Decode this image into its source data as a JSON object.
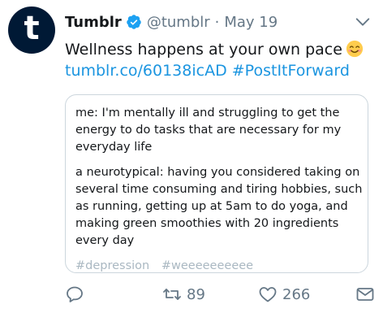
{
  "tweet": {
    "display_name": "Tumblr",
    "handle": "@tumblr",
    "separator": "·",
    "date": "May 19",
    "avatar_letter": "t",
    "text_line1": "Wellness happens at your own pace",
    "emoji_name": "smiling-face-emoji",
    "link": "tumblr.co/60138icAD",
    "hashtag": "#PostItForward"
  },
  "card": {
    "para1": [
      "me: I'm mentally ill and struggling to get the",
      "energy to do tasks that are necessary for my",
      "everyday life"
    ],
    "para2": [
      "a neurotypical: having you considered taking on",
      "several time consuming and tiring hobbies, such",
      "as running, getting up at 5am to do yoga, and",
      "making green smoothies with 20 ingredients",
      "every day"
    ],
    "tags": [
      "#depression",
      "#weeeeeeeeee"
    ]
  },
  "actions": {
    "retweet_count": "89",
    "like_count": "266"
  },
  "colors": {
    "avatar_bg": "#001935",
    "verified": "#1da1f2",
    "link": "#1b95e0",
    "muted": "#657786"
  },
  "icons": [
    "verified-badge-icon",
    "chevron-down-icon",
    "reply-icon",
    "retweet-icon",
    "like-icon",
    "share-icon"
  ]
}
